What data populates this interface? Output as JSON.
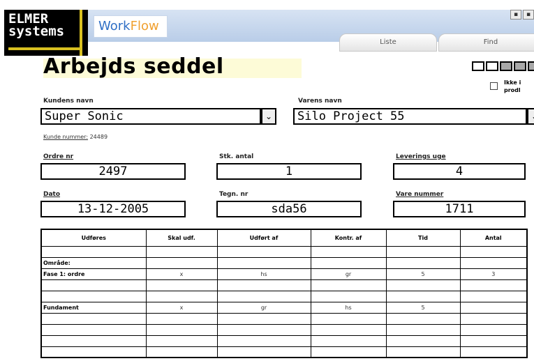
{
  "header": {
    "logo_line1": "ELMER",
    "logo_line2": "systems",
    "app_name_part1": "Work",
    "app_name_part2": "Flow",
    "window_controls": [
      "▪",
      "▪"
    ],
    "tabs": [
      {
        "label": "Liste"
      },
      {
        "label": "Find"
      }
    ]
  },
  "page": {
    "title": "Arbejds seddel",
    "not_production_label_line1": "Ikke i",
    "not_production_label_line2": "prodl"
  },
  "form": {
    "customer_name": {
      "label": "Kundens navn",
      "value": "Super Sonic"
    },
    "customer_number": {
      "label": "Kunde nummer:",
      "value": "24489"
    },
    "item_name": {
      "label": "Varens navn",
      "value": "Silo Project 55"
    },
    "order_no": {
      "label": "Ordre nr",
      "value": "2497"
    },
    "quantity": {
      "label": "Stk. antal",
      "value": "1"
    },
    "delivery_week": {
      "label": "Leverings uge",
      "value": "4"
    },
    "date": {
      "label": "Dato",
      "value": "13-12-2005"
    },
    "drawing_no": {
      "label": "Tegn. nr",
      "value": "sda56"
    },
    "item_number": {
      "label": "Vare nummer",
      "value": "1711"
    }
  },
  "table": {
    "columns": [
      "Udføres",
      "Skal udf.",
      "Udført af",
      "Kontr. af",
      "Tid",
      "Antal"
    ],
    "rows": [
      [
        "",
        "",
        "",
        "",
        "",
        ""
      ],
      [
        "Område:",
        "",
        "",
        "",
        "",
        ""
      ],
      [
        "Fase 1: ordre",
        "x",
        "hs",
        "gr",
        "5",
        "3"
      ],
      [
        "",
        "",
        "",
        "",
        "",
        ""
      ],
      [
        "",
        "",
        "",
        "",
        "",
        ""
      ],
      [
        "Fundament",
        "x",
        "gr",
        "hs",
        "5",
        ""
      ],
      [
        "",
        "",
        "",
        "",
        "",
        ""
      ],
      [
        "",
        "",
        "",
        "",
        "",
        ""
      ],
      [
        "",
        "",
        "",
        "",
        "",
        ""
      ],
      [
        "",
        "",
        "",
        "",
        "",
        ""
      ]
    ]
  }
}
